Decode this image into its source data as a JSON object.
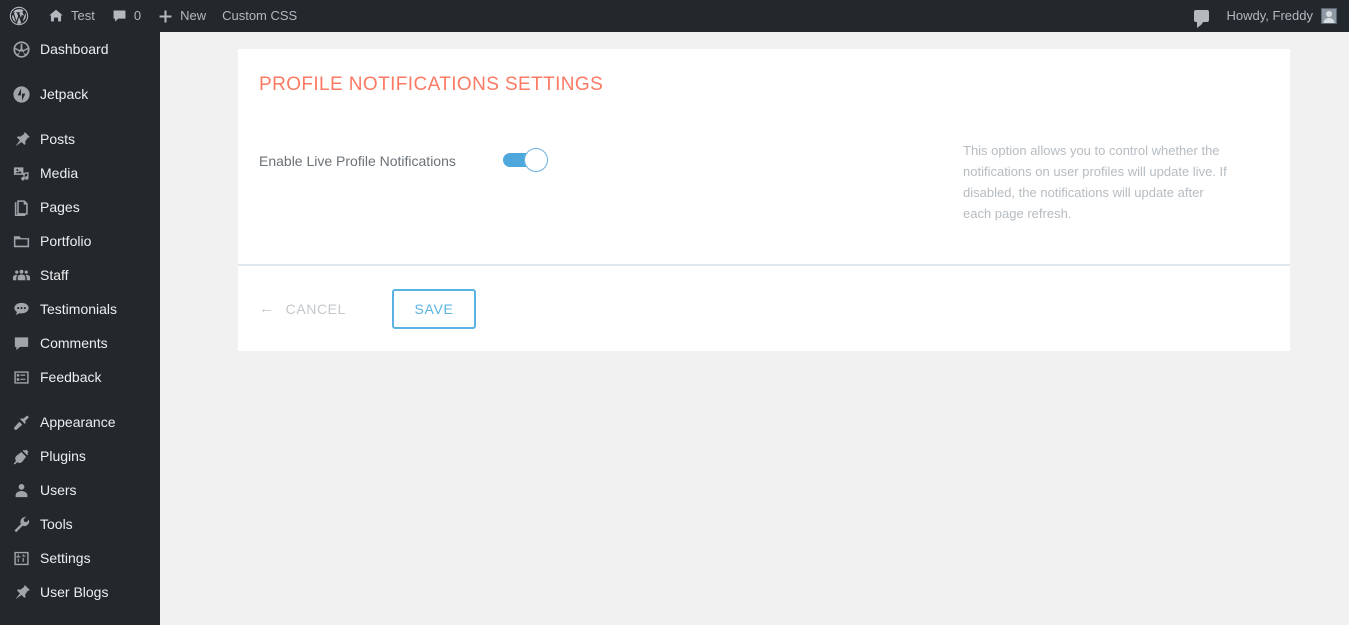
{
  "admin_bar": {
    "wp_logo_icon": "wordpress-logo-icon",
    "site_home_icon": "home-icon",
    "site_name": "Test",
    "comments_icon": "comment-bubble-icon",
    "comments_count": "0",
    "new_icon": "plus-icon",
    "new_label": "New",
    "custom_css_label": "Custom CSS",
    "notifications_icon": "comment-bubble-icon",
    "howdy_label": "Howdy, Freddy",
    "avatar_icon": "user-avatar",
    "background_color": "#23282d",
    "text_color": "#b4b9be"
  },
  "sidebar": {
    "background_color": "#23282d",
    "items": [
      {
        "label": "Dashboard",
        "icon": "dashboard-gauge-icon",
        "separator_after": true
      },
      {
        "label": "Jetpack",
        "icon": "jetpack-icon",
        "separator_after": true
      },
      {
        "label": "Posts",
        "icon": "pushpin-icon",
        "separator_after": false
      },
      {
        "label": "Media",
        "icon": "media-photo-music-icon",
        "separator_after": false
      },
      {
        "label": "Pages",
        "icon": "pages-icon",
        "separator_after": false
      },
      {
        "label": "Portfolio",
        "icon": "portfolio-folder-icon",
        "separator_after": false
      },
      {
        "label": "Staff",
        "icon": "staff-group-icon",
        "separator_after": false
      },
      {
        "label": "Testimonials",
        "icon": "testimonial-quote-bubble-icon",
        "separator_after": false
      },
      {
        "label": "Comments",
        "icon": "comment-bubble-icon",
        "separator_after": false
      },
      {
        "label": "Feedback",
        "icon": "feedback-form-icon",
        "separator_after": true
      },
      {
        "label": "Appearance",
        "icon": "appearance-brush-icon",
        "separator_after": false
      },
      {
        "label": "Plugins",
        "icon": "plugins-plug-icon",
        "separator_after": false
      },
      {
        "label": "Users",
        "icon": "users-person-icon",
        "separator_after": false
      },
      {
        "label": "Tools",
        "icon": "tools-wrench-icon",
        "separator_after": false
      },
      {
        "label": "Settings",
        "icon": "settings-sliders-icon",
        "separator_after": false
      },
      {
        "label": "User Blogs",
        "icon": "pushpin-icon",
        "separator_after": false
      }
    ]
  },
  "panel": {
    "title": "PROFILE NOTIFICATIONS SETTINGS",
    "title_color": "#fc7a63",
    "background_color": "#ffffff",
    "divider_color": "#e1e8ed"
  },
  "options": [
    {
      "label": "Enable Live Profile Notifications",
      "toggle": {
        "state": "on",
        "track_color": "#4fa8dd",
        "knob_color": "#ffffff",
        "icon": "toggle-switch"
      },
      "description": "This option allows you to control whether the notifications on user profiles will update live. If disabled, the notifications will update after each page refresh."
    }
  ],
  "actions": {
    "cancel_arrow_icon": "arrow-left-icon",
    "cancel_label": "CANCEL",
    "cancel_color": "#c3c8cc",
    "save_label": "SAVE",
    "save_accent_color": "#5bb3e4"
  },
  "page": {
    "background_color": "#f1f1f1"
  }
}
